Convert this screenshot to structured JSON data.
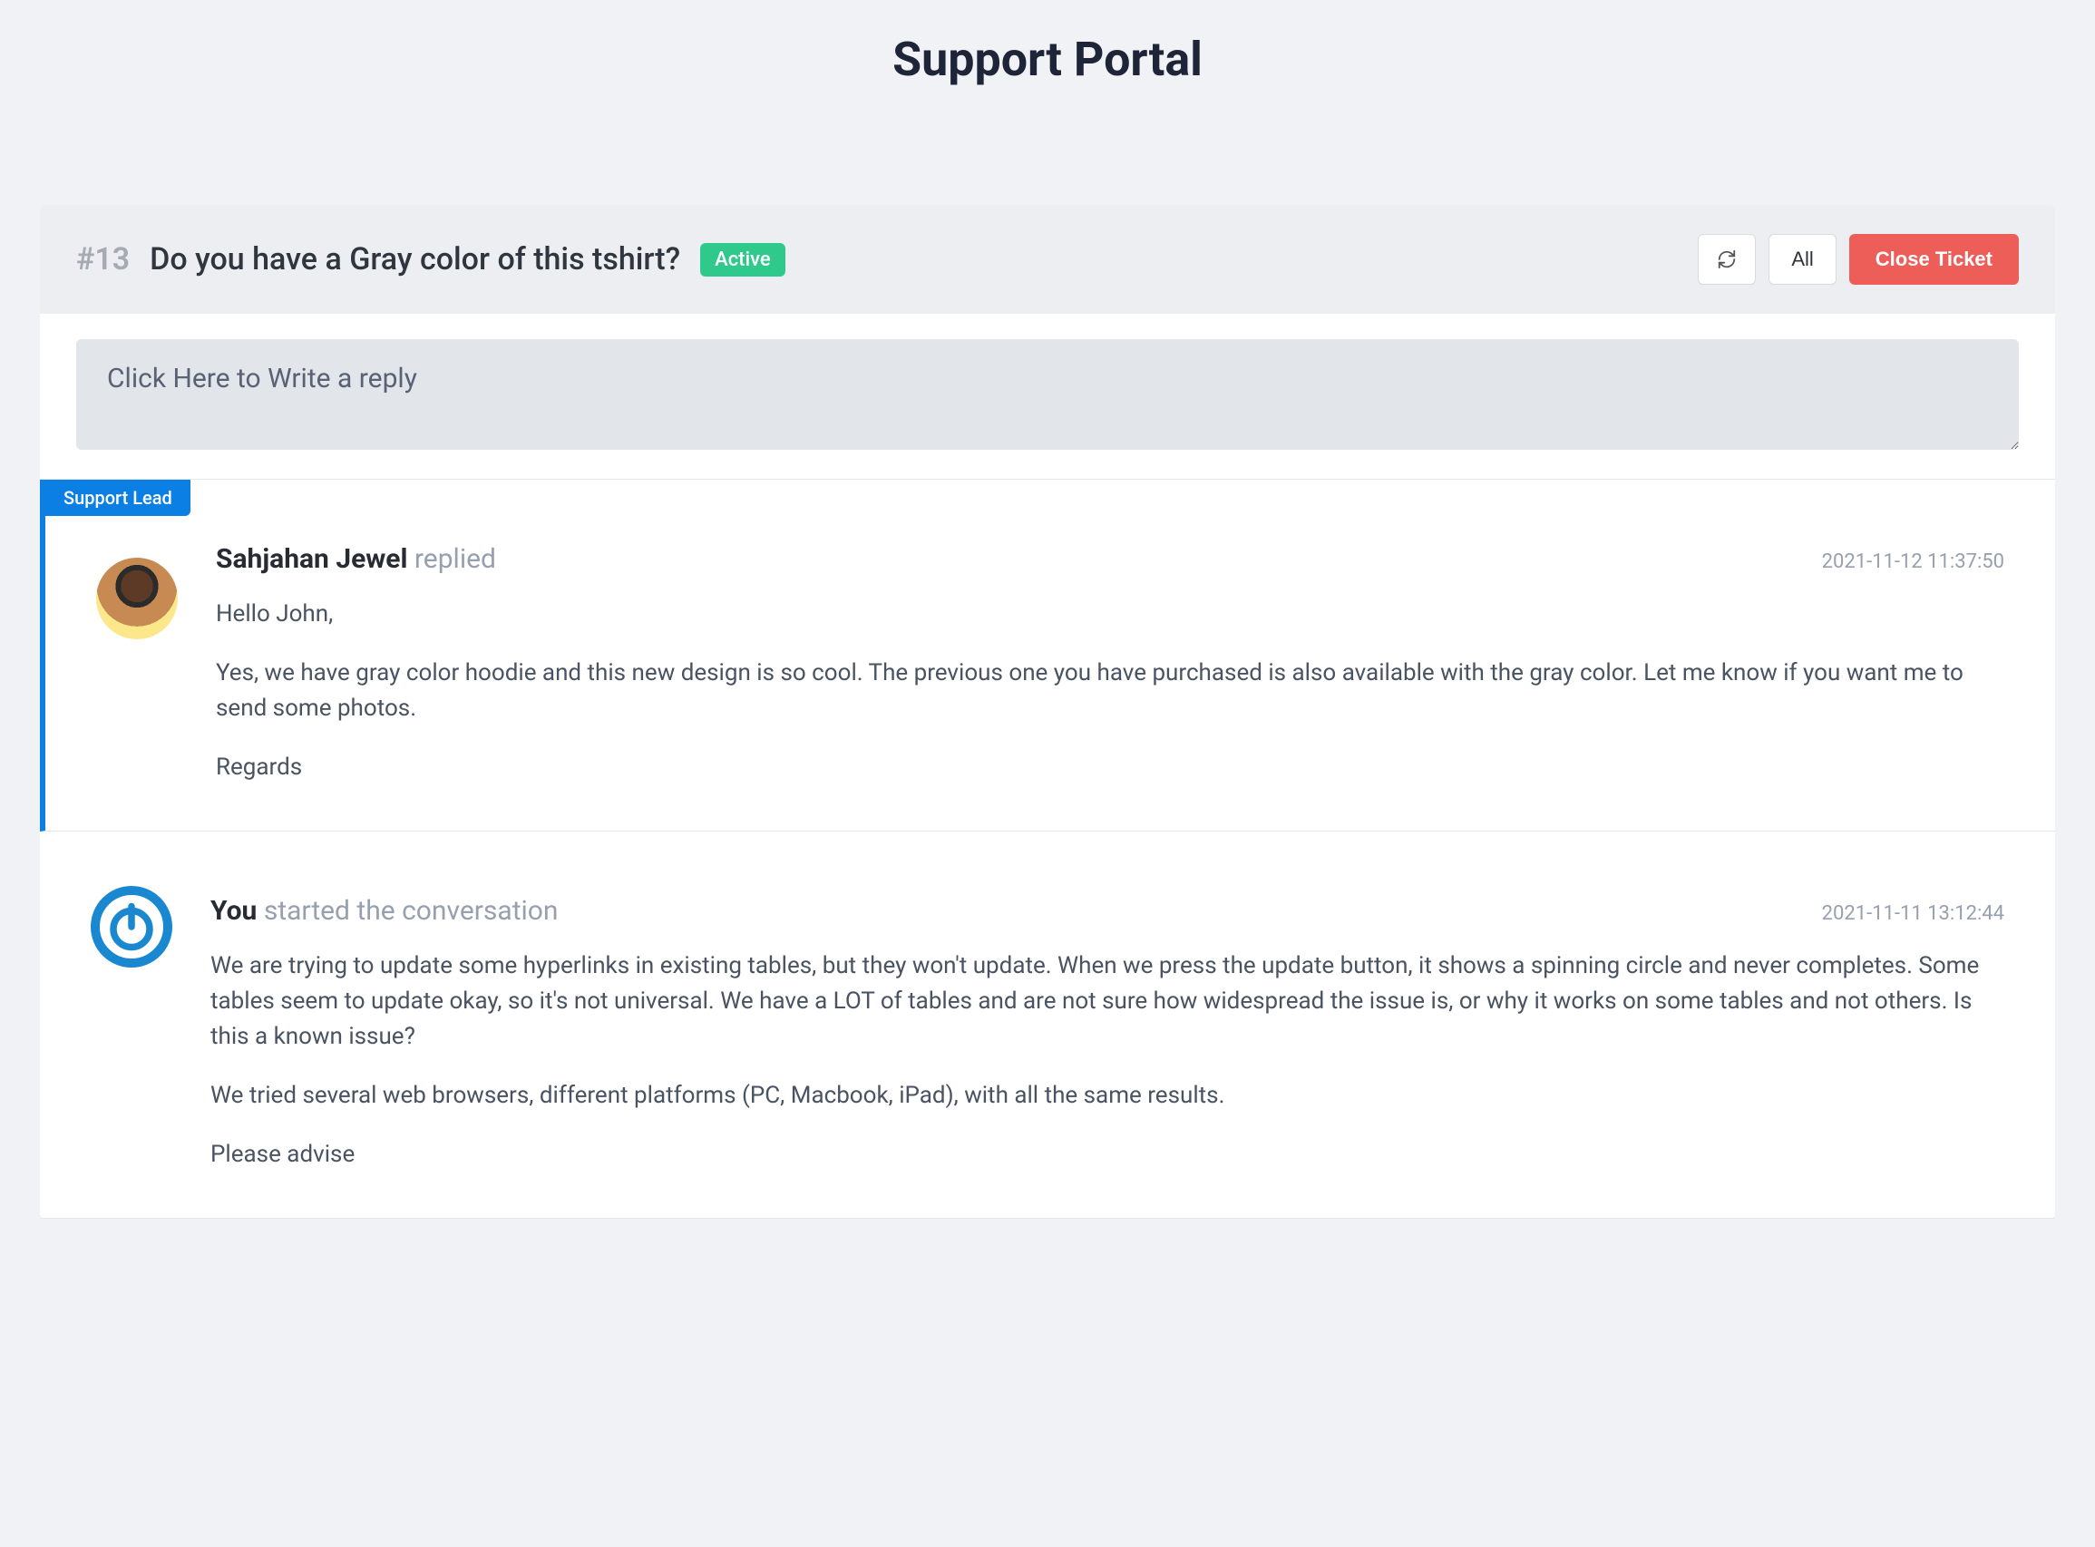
{
  "header": {
    "title": "Support Portal"
  },
  "ticket": {
    "id_prefix": "#13",
    "title": "Do you have a Gray color of this tshirt?",
    "status": "Active",
    "actions": {
      "all": "All",
      "close": "Close Ticket"
    }
  },
  "reply": {
    "placeholder": "Click Here to Write a reply"
  },
  "conversation": [
    {
      "role_tag": "Support Lead",
      "is_support": true,
      "avatar": "jewel",
      "name": "Sahjahan Jewel",
      "action": "replied",
      "timestamp": "2021-11-12 11:37:50",
      "body": [
        "Hello John,",
        "Yes, we have gray color hoodie and this new design is so cool. The previous one you have purchased is also available with the gray color. Let me know if you want me to send some photos.",
        "Regards"
      ]
    },
    {
      "is_support": false,
      "avatar": "you",
      "name": "You",
      "action": "started the conversation",
      "timestamp": "2021-11-11 13:12:44",
      "body": [
        "We are trying to update some hyperlinks in existing tables, but they won't update. When we press the update button, it shows a spinning circle and never completes. Some tables seem to update okay, so it's not universal. We have a LOT of tables and are not sure how widespread the issue is, or why it works on some tables and not others. Is this a known issue?",
        "We tried several web browsers, different platforms (PC, Macbook, iPad), with all the same results.",
        "Please advise"
      ]
    }
  ]
}
